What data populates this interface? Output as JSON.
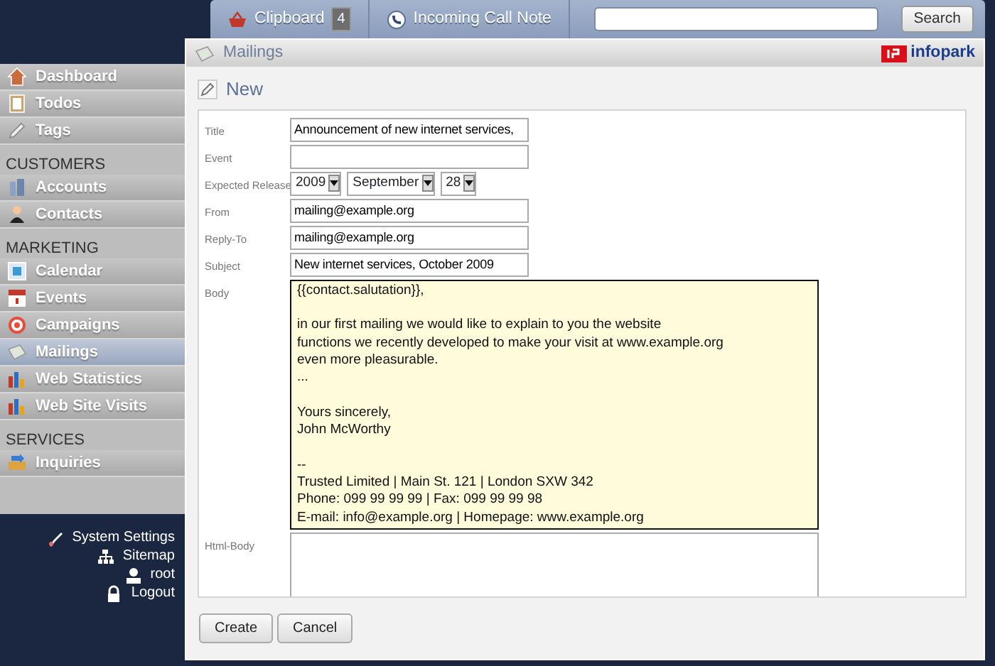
{
  "topbar": {
    "tabs": [
      {
        "label": "Clipboard",
        "badge": "4"
      },
      {
        "label": "Incoming Call Note"
      }
    ],
    "search_button": "Search"
  },
  "sidebar": {
    "sections": [
      {
        "items": [
          {
            "label": "Dashboard",
            "selected": false
          },
          {
            "label": "Todos",
            "selected": false
          },
          {
            "label": "Tags",
            "selected": false
          }
        ]
      },
      {
        "heading": "CUSTOMERS",
        "items": [
          {
            "label": "Accounts",
            "selected": false
          },
          {
            "label": "Contacts",
            "selected": false
          }
        ]
      },
      {
        "heading": "MARKETING",
        "items": [
          {
            "label": "Calendar",
            "selected": false
          },
          {
            "label": "Events",
            "selected": false
          },
          {
            "label": "Campaigns",
            "selected": false
          },
          {
            "label": "Mailings",
            "selected": true
          },
          {
            "label": "Web Statistics",
            "selected": false
          },
          {
            "label": "Web Site Visits",
            "selected": false
          }
        ]
      },
      {
        "heading": "SERVICES",
        "items": [
          {
            "label": "Inquiries",
            "selected": false
          }
        ]
      }
    ]
  },
  "footer_links": [
    "System Settings",
    "Sitemap",
    "root",
    "Logout"
  ],
  "dialog": {
    "title": "Mailings",
    "logo": "infopark",
    "heading": "New",
    "fields": [
      {
        "label": "Title",
        "kind": "text",
        "value": "Announcement of new internet services,"
      },
      {
        "label": "Event",
        "kind": "text"
      },
      {
        "label": "Expected Release",
        "kind": "date",
        "selects": [
          "2009",
          "September",
          "28"
        ]
      },
      {
        "label": "From",
        "kind": "text",
        "value": "mailing@example.org"
      },
      {
        "label": "Reply-To",
        "kind": "text",
        "value": "mailing@example.org"
      },
      {
        "label": "Subject",
        "kind": "text",
        "value": "New internet services, October 2009"
      },
      {
        "label": "Body",
        "kind": "rich",
        "value": "{{contact.salutation}},\n\nin our first mailing we would like to explain to you the website\nfunctions we recently developed to make your visit at www.example.org\neven more pleasurable.\n...\n\nYours sincerely,\nJohn McWorthy\n\n--\nTrusted Limited | Main St. 121 | London SXW 342\nPhone: 099 99 99 99 | Fax: 099 99 99 98\nE-mail: info@example.org | Homepage: www.example.org"
      },
      {
        "label": "Html-Body",
        "kind": "area"
      }
    ],
    "buttons": [
      "Create",
      "Cancel"
    ]
  }
}
